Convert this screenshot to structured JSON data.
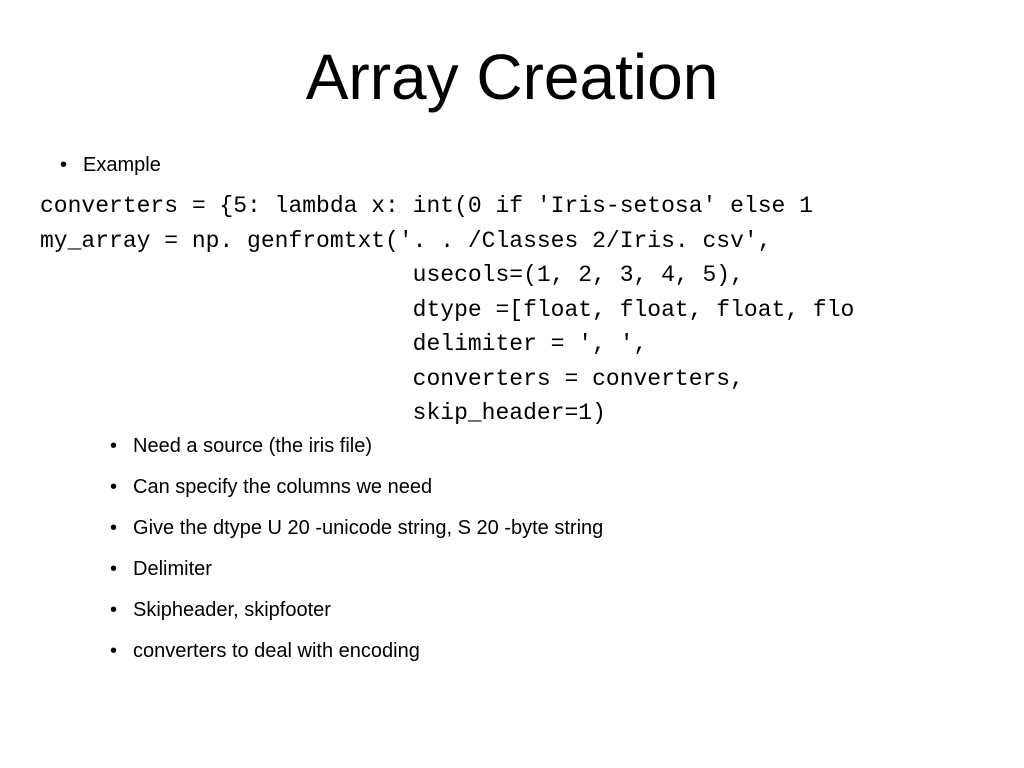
{
  "title": "Array Creation",
  "exampleLabel": "Example",
  "code": "converters = {5: lambda x: int(0 if 'Iris-setosa' else 1\nmy_array = np. genfromtxt('. . /Classes 2/Iris. csv',\n                           usecols=(1, 2, 3, 4, 5),\n                           dtype =[float, float, float, flo\n                           delimiter = ', ',\n                           converters = converters,\n                           skip_header=1)",
  "innerBullets": [
    "Need a source (the iris file)",
    "Can specify the columns we need",
    "Give the dtype U 20 -unicode string, S 20 -byte string",
    "Delimiter",
    "Skipheader, skipfooter",
    "converters to deal with encoding"
  ]
}
